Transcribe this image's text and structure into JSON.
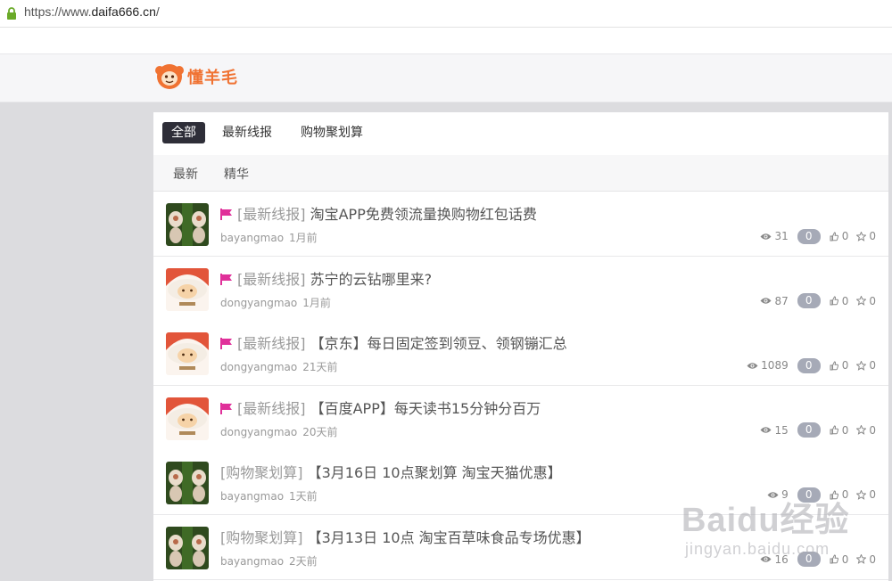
{
  "browser": {
    "url_prefix": "https://www.",
    "url_host": "daifa666.cn",
    "url_suffix": "/"
  },
  "site": {
    "logo_text": "懂羊毛"
  },
  "tabs": [
    {
      "label": "全部",
      "active": true
    },
    {
      "label": "最新线报",
      "active": false
    },
    {
      "label": "购物聚划算",
      "active": false
    }
  ],
  "subtabs": [
    {
      "label": "最新"
    },
    {
      "label": "精华"
    }
  ],
  "posts": [
    {
      "flag": true,
      "category": "[最新线报]",
      "title": "淘宝APP免费领流量换购物红包话费",
      "author": "bayangmao",
      "time": "1月前",
      "views": "31",
      "replies": "0",
      "likes": "0",
      "stars": "0",
      "avatar": "green-sheep"
    },
    {
      "flag": true,
      "category": "[最新线报]",
      "title": "苏宁的云钻哪里来?",
      "author": "dongyangmao",
      "time": "1月前",
      "views": "87",
      "replies": "0",
      "likes": "0",
      "stars": "0",
      "avatar": "orange-sheep"
    },
    {
      "flag": true,
      "category": "[最新线报]",
      "title": "【京东】每日固定签到领豆、领钢镚汇总",
      "author": "dongyangmao",
      "time": "21天前",
      "views": "1089",
      "replies": "0",
      "likes": "0",
      "stars": "0",
      "avatar": "orange-sheep"
    },
    {
      "flag": true,
      "category": "[最新线报]",
      "title": "【百度APP】每天读书15分钟分百万",
      "author": "dongyangmao",
      "time": "20天前",
      "views": "15",
      "replies": "0",
      "likes": "0",
      "stars": "0",
      "avatar": "orange-sheep"
    },
    {
      "flag": false,
      "category": "[购物聚划算]",
      "title": "【3月16日 10点聚划算 淘宝天猫优惠】",
      "author": "bayangmao",
      "time": "1天前",
      "views": "9",
      "replies": "0",
      "likes": "0",
      "stars": "0",
      "avatar": "green-sheep"
    },
    {
      "flag": false,
      "category": "[购物聚划算]",
      "title": "【3月13日 10点 淘宝百草味食品专场优惠】",
      "author": "bayangmao",
      "time": "2天前",
      "views": "16",
      "replies": "0",
      "likes": "0",
      "stars": "0",
      "avatar": "green-sheep"
    }
  ],
  "watermark": {
    "big": "Baidu经验",
    "small": "jingyan.baidu.com"
  },
  "colors": {
    "flag": "#e0309a",
    "active_tab": "#2e2e38",
    "badge": "#a6aab7",
    "logo": "#f07232"
  }
}
